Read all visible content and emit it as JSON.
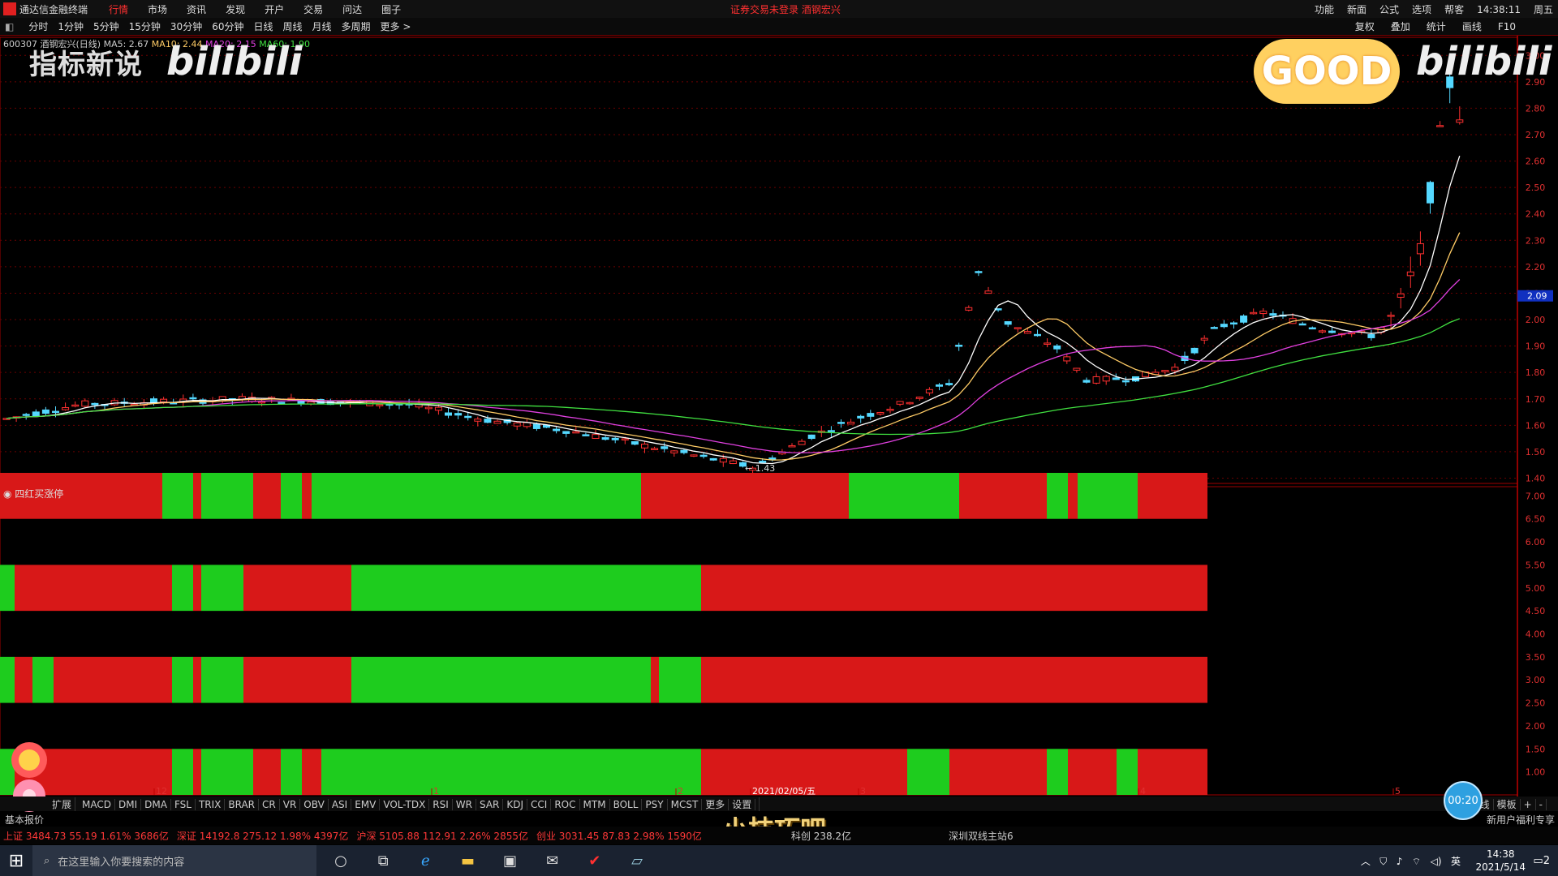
{
  "app": {
    "title": "通达信金融终端",
    "menu": [
      "行情",
      "市场",
      "资讯",
      "发现",
      "开户",
      "交易",
      "问达",
      "圈子"
    ],
    "active_menu": "行情",
    "warning": "证券交易未登录   酒钢宏兴",
    "right_menu": [
      "功能",
      "新面",
      "公式",
      "选项",
      "帮客",
      "14:38:11",
      "周五"
    ]
  },
  "period_bar": {
    "items": [
      "分时",
      "1分钟",
      "5分钟",
      "15分钟",
      "30分钟",
      "60分钟",
      "日线",
      "周线",
      "月线",
      "多周期",
      "更多 >"
    ],
    "right_items": [
      "复权",
      "叠加",
      "统计",
      "画线",
      "F10"
    ]
  },
  "stock_info": {
    "code_name": "600307 酒钢宏兴(日线)",
    "ma5": "MA5: 2.67",
    "ma10": "MA10: 2.44",
    "ma20": "MA20: 2.15",
    "ma60": "MA60: 1.90"
  },
  "watermarks": {
    "channel": "指标新说",
    "logo": "bilibili",
    "good": "GOOD"
  },
  "chart_data": [
    {
      "type": "candlestick",
      "title": "600307 酒钢宏兴(日线)",
      "ylim": [
        1.38,
        3.05
      ],
      "y_ticks": [
        1.4,
        1.5,
        1.6,
        1.7,
        1.8,
        1.9,
        2.0,
        2.1,
        2.2,
        2.3,
        2.4,
        2.5,
        2.6,
        2.7,
        2.8,
        2.9,
        3.0
      ],
      "x_ticks": [
        "12",
        "1",
        "2",
        "2021/02/05/五",
        "3",
        "4",
        "5"
      ],
      "low_label": "1.43",
      "current_price_label": "2.09",
      "series": [
        {
          "name": "MA5",
          "color": "#ffffff"
        },
        {
          "name": "MA10",
          "color": "#ffcc66"
        },
        {
          "name": "MA20",
          "color": "#e040e0"
        },
        {
          "name": "MA60",
          "color": "#40e040"
        }
      ]
    },
    {
      "type": "bar",
      "title": "四红买涨停",
      "ylim": [
        0.5,
        7.2
      ],
      "y_ticks": [
        1.0,
        1.5,
        2.0,
        2.5,
        3.0,
        3.5,
        4.0,
        4.5,
        5.0,
        5.5,
        6.0,
        6.5,
        7.0
      ],
      "rows": [
        {
          "level": 6.5,
          "segments": [
            [
              "r",
              0,
              200
            ],
            [
              "g",
              200,
              238
            ],
            [
              "r",
              238,
              248
            ],
            [
              "g",
              248,
              312
            ],
            [
              "r",
              312,
              346
            ],
            [
              "g",
              346,
              372
            ],
            [
              "r",
              372,
              384
            ],
            [
              "g",
              384,
              790
            ],
            [
              "r",
              790,
              1046
            ],
            [
              "g",
              1046,
              1182
            ],
            [
              "r",
              1182,
              1290
            ],
            [
              "g",
              1290,
              1316
            ],
            [
              "r",
              1316,
              1328
            ],
            [
              "g",
              1328,
              1402
            ],
            [
              "r",
              1402,
              1488
            ]
          ]
        },
        {
          "level": 4.5,
          "segments": [
            [
              "g",
              0,
              18
            ],
            [
              "r",
              18,
              212
            ],
            [
              "g",
              212,
              238
            ],
            [
              "r",
              238,
              248
            ],
            [
              "g",
              248,
              300
            ],
            [
              "r",
              300,
              433
            ],
            [
              "g",
              433,
              864
            ],
            [
              "r",
              864,
              1488
            ]
          ]
        },
        {
          "level": 2.5,
          "segments": [
            [
              "g",
              0,
              18
            ],
            [
              "r",
              18,
              40
            ],
            [
              "g",
              40,
              66
            ],
            [
              "r",
              66,
              212
            ],
            [
              "g",
              212,
              238
            ],
            [
              "r",
              238,
              248
            ],
            [
              "g",
              248,
              300
            ],
            [
              "r",
              300,
              433
            ],
            [
              "g",
              433,
              802
            ],
            [
              "r",
              802,
              812
            ],
            [
              "g",
              812,
              864
            ],
            [
              "r",
              864,
              1488
            ]
          ]
        },
        {
          "level": 0.5,
          "segments": [
            [
              "g",
              0,
              18
            ],
            [
              "r",
              18,
              212
            ],
            [
              "g",
              212,
              238
            ],
            [
              "r",
              238,
              248
            ],
            [
              "g",
              248,
              312
            ],
            [
              "r",
              312,
              346
            ],
            [
              "g",
              346,
              372
            ],
            [
              "r",
              372,
              396
            ],
            [
              "g",
              396,
              864
            ],
            [
              "r",
              864,
              1118
            ],
            [
              "g",
              1118,
              1170
            ],
            [
              "r",
              1170,
              1290
            ],
            [
              "g",
              1290,
              1316
            ],
            [
              "r",
              1316,
              1376
            ],
            [
              "g",
              1376,
              1402
            ],
            [
              "r",
              1402,
              1488
            ]
          ]
        }
      ]
    }
  ],
  "indicator_label": "四红买涨停",
  "tabs": [
    "MACD",
    "DMI",
    "DMA",
    "FSL",
    "TRIX",
    "BRAR",
    "CR",
    "VR",
    "OBV",
    "ASI",
    "EMV",
    "VOL-TDX",
    "RSI",
    "WR",
    "SAR",
    "KDJ",
    "CCI",
    "ROC",
    "MTM",
    "BOLL",
    "PSY",
    "MCST",
    "更多",
    "设置"
  ],
  "tab_left": "扩展",
  "tab_left2": "基本报价",
  "right_bottom": [
    "日线",
    "模板",
    "+",
    "-"
  ],
  "notice": "新用户福利专享",
  "subtitle": "小技巧吧",
  "timer": "00:20",
  "quotes": {
    "sh": "上证 3484.73  55.19  1.61%  3686亿",
    "sz": "深证 14192.8  275.12  1.98%  4397亿",
    "hs": "沪深 5105.88  112.91  2.26%  2855亿",
    "cy": "创业 3031.45  87.83  2.98%  1590亿",
    "kc": "科创  238.2亿",
    "station": "深圳双线主站6"
  },
  "taskbar": {
    "search_placeholder": "在这里输入你要搜索的内容",
    "time": "14:38",
    "date": "2021/5/14",
    "lang": "英",
    "notif": "2"
  }
}
